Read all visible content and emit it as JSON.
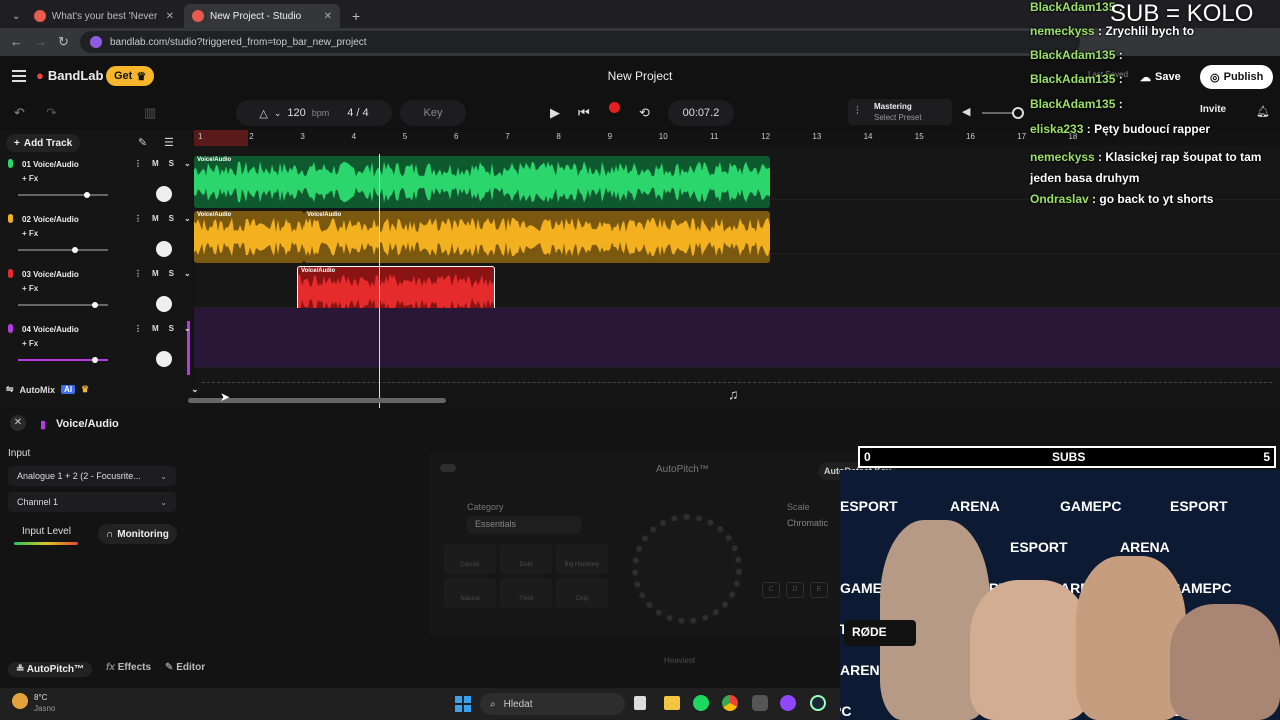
{
  "browser": {
    "tabs": [
      {
        "title": "What's your best 'Never have I",
        "active": false
      },
      {
        "title": "New Project - Studio",
        "active": true
      }
    ],
    "url": "bandlab.com/studio?triggered_from=top_bar_new_project"
  },
  "app": {
    "brand": "BandLab",
    "get_label": "Get",
    "project_title": "New Project",
    "save_label": "Save",
    "publish_label": "Publish",
    "invite_label": "Invite",
    "last_saved": "Last Saved"
  },
  "transport": {
    "tempo": "120",
    "tempo_unit": "bpm",
    "time_signature": "4 / 4",
    "key_label": "Key",
    "time": "00:07.2",
    "mastering_title": "Mastering",
    "mastering_preset": "Select Preset"
  },
  "tracks": {
    "add_track": "Add Track",
    "items": [
      {
        "name": "01  Voice/Audio",
        "fx": "+ Fx",
        "color": "#2bd66d",
        "volume": 0.77
      },
      {
        "name": "02  Voice/Audio",
        "fx": "+ Fx",
        "color": "#f3b120",
        "volume": 0.63
      },
      {
        "name": "03  Voice/Audio",
        "fx": "+ Fx",
        "color": "#e52b2b",
        "volume": 0.86
      },
      {
        "name": "04  Voice/Audio",
        "fx": "+ Fx",
        "color": "#b53be0",
        "volume": 0.86
      }
    ],
    "mute_label": "M",
    "solo_label": "S",
    "automix_label": "AutoMix",
    "ai_label": "AI"
  },
  "timeline": {
    "bars": [
      "1",
      "2",
      "3",
      "4",
      "5",
      "6",
      "7",
      "8",
      "9",
      "10",
      "11",
      "12",
      "13",
      "14",
      "15",
      "16",
      "17",
      "18"
    ],
    "clip_label": "Voice/Audio"
  },
  "editor": {
    "title": "Voice/Audio",
    "input_label": "Input",
    "input_device": "Analogue 1 + 2 (2 - Focusrite...",
    "channel": "Channel 1",
    "input_level_label": "Input Level",
    "monitoring_label": "Monitoring",
    "autopitch_title": "AutoPitch™",
    "autodetect": "AutoDetect Key",
    "category_label": "Category",
    "category_value": "Essentials",
    "scale_label": "Scale",
    "scale_value": "Chromatic",
    "presets": [
      "Classic",
      "Duet",
      "Big Harmony",
      "Natural",
      "Third",
      "Chip"
    ],
    "knob_label": "Heaviest",
    "notes": [
      "C",
      "D",
      "E"
    ],
    "tabs": [
      "AutoPitch™",
      "Effects",
      "Editor"
    ]
  },
  "taskbar": {
    "weather_temp": "8°C",
    "weather_desc": "Jasno",
    "search_placeholder": "Hledat"
  },
  "stream": {
    "sub_goal": "SUB = KOLO",
    "subs_label": "SUBS",
    "subs_current": "0",
    "subs_target": "5",
    "subs_progress": 0,
    "chat": [
      {
        "user": "BlackAdam135",
        "msg": ""
      },
      {
        "user": "nemeckyss",
        "msg": "Zrychlil bych to"
      },
      {
        "user": "BlackAdam135",
        "msg": ""
      },
      {
        "user": "BlackAdam135",
        "msg": ""
      },
      {
        "user": "BlackAdam135",
        "msg": ""
      },
      {
        "user": "eliska233",
        "msg": "Pęty budoucí rapper"
      },
      {
        "user": "nemeckyss",
        "msg": "Klasickej rap šoupat to tam jeden basa druhym"
      },
      {
        "user": "Ondraslav",
        "msg": "go back to yt shorts"
      }
    ],
    "banner_words": [
      "ESPORT",
      "ARENA",
      "GAMEPC"
    ],
    "mic_brand": "RØDE"
  }
}
